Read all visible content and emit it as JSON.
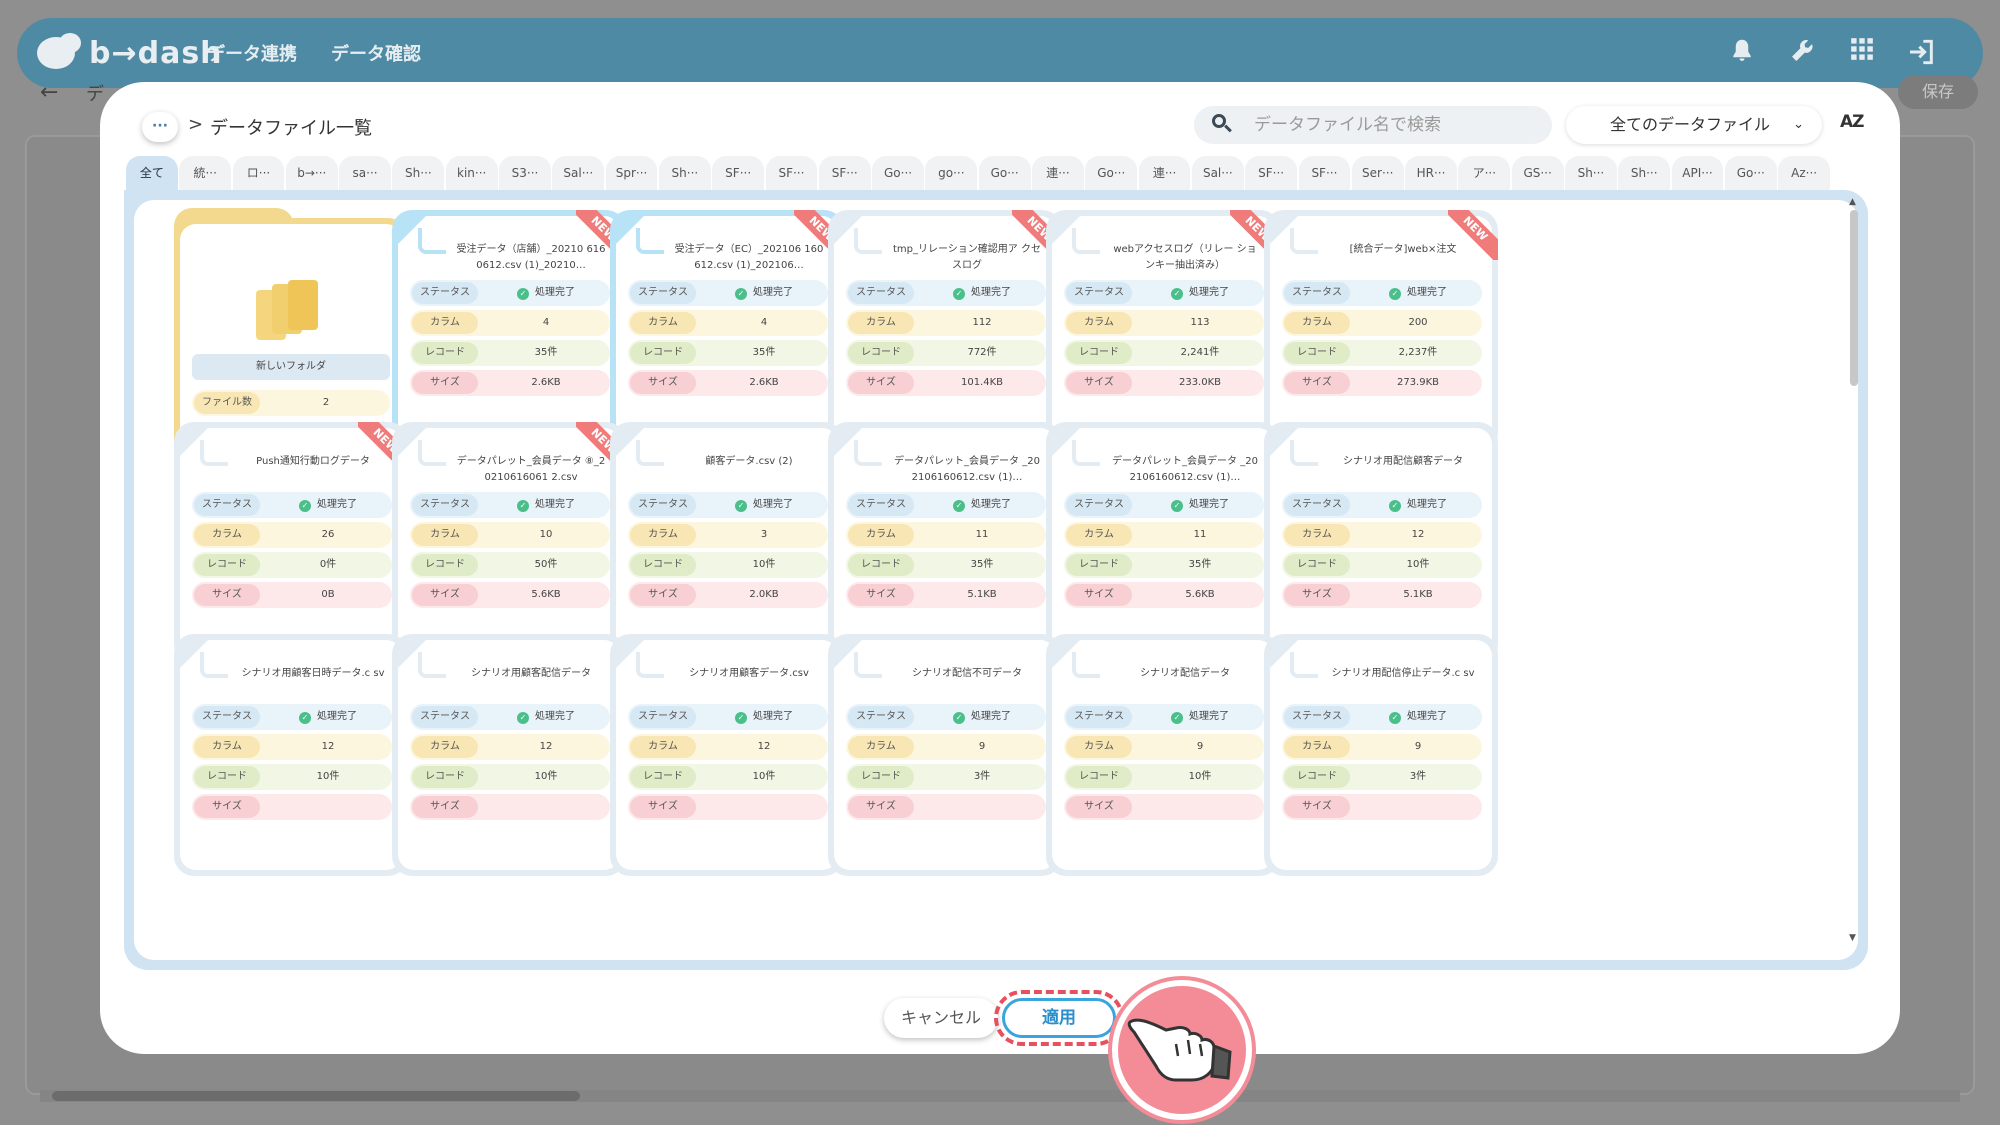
{
  "app": {
    "logo": "b→dash",
    "nav": [
      "データ連携",
      "データ確認"
    ],
    "back_arrow": "←",
    "bg_crumb": "デ",
    "save_label": "保存"
  },
  "modal": {
    "crumb_more": "···",
    "crumb_sep": ">",
    "title": "データファイル一覧",
    "search_placeholder": "データファイル名で検索",
    "filter_value": "全てのデータファイル",
    "filter_chevron": "⌄",
    "sort_label": "AZ",
    "tabs": [
      "全て",
      "統···",
      "ロ···",
      "b→···",
      "sa···",
      "Sh···",
      "kin···",
      "S3···",
      "Sal···",
      "Spr···",
      "Sh···",
      "SF···",
      "SF···",
      "SF···",
      "Go···",
      "go···",
      "Go···",
      "連···",
      "Go···",
      "連···",
      "Sal···",
      "SF···",
      "SF···",
      "Ser···",
      "HR···",
      "ア···",
      "GS···",
      "Sh···",
      "Sh···",
      "API···",
      "Go···",
      "Az···"
    ],
    "labels": {
      "status": "ステータス",
      "columns": "カラム",
      "records": "レコード",
      "size": "サイズ",
      "file_count": "ファイル数"
    },
    "new_badge": "NEW",
    "check_glyph": "✓",
    "folder": {
      "name": "新しいフォルダ",
      "file_count": "2"
    },
    "files": [
      {
        "title": "受注データ（店舗）_20210 6160612.csv (1)_20210…",
        "status": "処理完了",
        "columns": "4",
        "records": "35件",
        "size": "2.6KB",
        "new": true,
        "selected": true
      },
      {
        "title": "受注データ（EC）_202106 160612.csv (1)_202106…",
        "status": "処理完了",
        "columns": "4",
        "records": "35件",
        "size": "2.6KB",
        "new": true,
        "selected": true
      },
      {
        "title": "tmp_リレーション確認用ア クセスログ",
        "status": "処理完了",
        "columns": "112",
        "records": "772件",
        "size": "101.4KB",
        "new": true,
        "selected": false
      },
      {
        "title": "webアクセスログ（リレー ションキー抽出済み）",
        "status": "処理完了",
        "columns": "113",
        "records": "2,241件",
        "size": "233.0KB",
        "new": true,
        "selected": false
      },
      {
        "title": "[統合データ]web×注文",
        "status": "処理完了",
        "columns": "200",
        "records": "2,237件",
        "size": "273.9KB",
        "new": true,
        "selected": false
      },
      {
        "title": "Push通知行動ログデータ",
        "status": "処理完了",
        "columns": "26",
        "records": "0件",
        "size": "0B",
        "new": true,
        "selected": false
      },
      {
        "title": "データパレット_会員データ ⑧_20210616061 2.csv",
        "status": "処理完了",
        "columns": "10",
        "records": "50件",
        "size": "5.6KB",
        "new": true,
        "selected": false
      },
      {
        "title": "顧客データ.csv (2)",
        "status": "処理完了",
        "columns": "3",
        "records": "10件",
        "size": "2.0KB",
        "new": false,
        "selected": false
      },
      {
        "title": "データパレット_会員データ _202106160612.csv (1)…",
        "status": "処理完了",
        "columns": "11",
        "records": "35件",
        "size": "5.1KB",
        "new": false,
        "selected": false
      },
      {
        "title": "データパレット_会員データ _202106160612.csv (1)…",
        "status": "処理完了",
        "columns": "11",
        "records": "35件",
        "size": "5.6KB",
        "new": false,
        "selected": false
      },
      {
        "title": "シナリオ用配信顧客データ",
        "status": "処理完了",
        "columns": "12",
        "records": "10件",
        "size": "5.1KB",
        "new": false,
        "selected": false
      },
      {
        "title": "シナリオ用顧客日時データ.c sv",
        "status": "処理完了",
        "columns": "12",
        "records": "10件",
        "size": "",
        "new": false,
        "selected": false
      },
      {
        "title": "シナリオ用顧客配信データ",
        "status": "処理完了",
        "columns": "12",
        "records": "10件",
        "size": "",
        "new": false,
        "selected": false
      },
      {
        "title": "シナリオ用顧客データ.csv",
        "status": "処理完了",
        "columns": "12",
        "records": "10件",
        "size": "",
        "new": false,
        "selected": false
      },
      {
        "title": "シナリオ配信不可データ",
        "status": "処理完了",
        "columns": "9",
        "records": "3件",
        "size": "",
        "new": false,
        "selected": false
      },
      {
        "title": "シナリオ配信データ",
        "status": "処理完了",
        "columns": "9",
        "records": "10件",
        "size": "",
        "new": false,
        "selected": false
      },
      {
        "title": "シナリオ用配信停止データ.c sv",
        "status": "処理完了",
        "columns": "9",
        "records": "3件",
        "size": "",
        "new": false,
        "selected": false
      }
    ],
    "cancel_label": "キャンセル",
    "apply_label": "適用"
  },
  "colors": {
    "header": "#4f8aa4",
    "accent": "#3aa4dd",
    "highlight": "#e8505d",
    "new_badge": "#f07b7b",
    "status_ok": "#4bbf8a"
  }
}
